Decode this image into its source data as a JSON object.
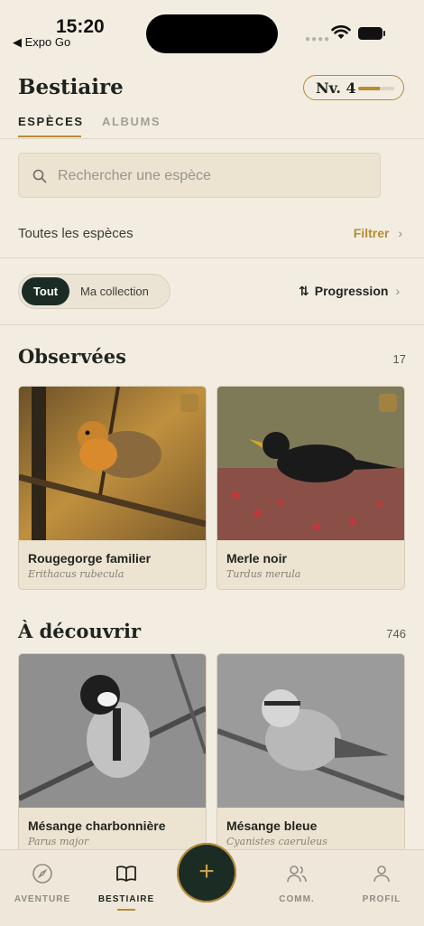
{
  "status": {
    "time": "15:20",
    "back_label": "◀ Expo Go",
    "dots": "●●●●"
  },
  "header": {
    "title": "Bestiaire",
    "level_label": "Nv. 4",
    "level_progress": 0.6
  },
  "tabs": [
    {
      "label": "ESPÈCES",
      "active": true
    },
    {
      "label": "ALBUMS",
      "active": false
    }
  ],
  "search": {
    "placeholder": "Rechercher une espèce",
    "value": ""
  },
  "filter_row": {
    "label": "Toutes les espèces",
    "action": "Filtrer"
  },
  "segmented": {
    "options": [
      "Tout",
      "Ma collection"
    ],
    "selected": "Tout"
  },
  "sort": {
    "label": "Progression"
  },
  "sections": [
    {
      "title": "Observées",
      "count": "17",
      "cards": [
        {
          "name": "Rougegorge familier",
          "latin": "Erithacus rubecula",
          "badge": "trophy-icon"
        },
        {
          "name": "Merle noir",
          "latin": "Turdus merula",
          "badge": "camera-icon"
        }
      ]
    },
    {
      "title": "À découvrir",
      "count": "746",
      "cards": [
        {
          "name": "Mésange charbonnière",
          "latin": "Parus major"
        },
        {
          "name": "Mésange bleue",
          "latin": "Cyanistes caeruleus"
        }
      ]
    }
  ],
  "nav": [
    {
      "label": "AVENTURE",
      "icon": "compass-icon"
    },
    {
      "label": "BESTIAIRE",
      "icon": "book-icon",
      "active": true
    },
    {
      "label": "COMM.",
      "icon": "users-icon"
    },
    {
      "label": "PROFIL",
      "icon": "user-icon"
    }
  ],
  "colors": {
    "accent": "#b68c35",
    "dark": "#1b2c24",
    "background": "#f3ede1"
  }
}
